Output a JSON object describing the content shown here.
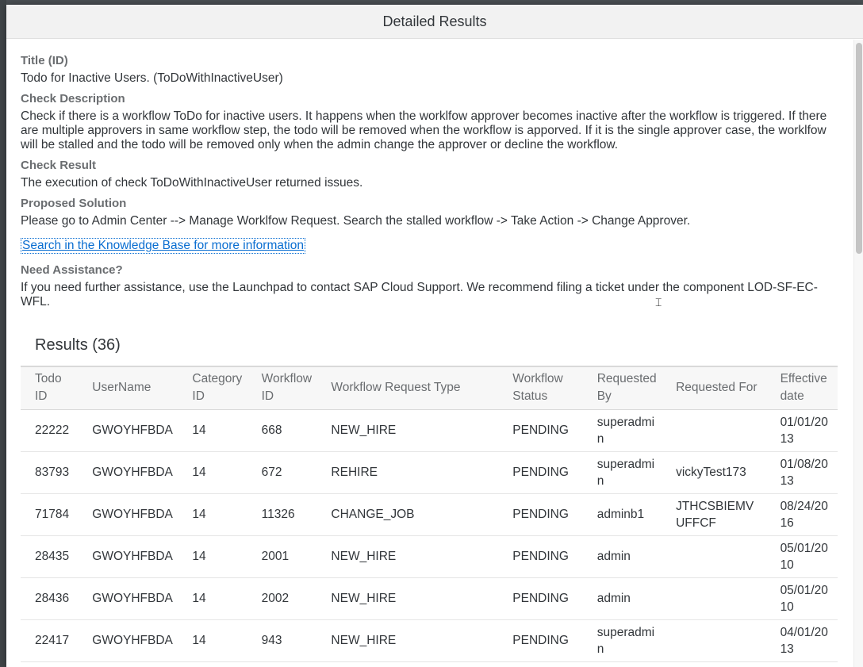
{
  "dialog": {
    "title": "Detailed Results"
  },
  "details": {
    "title_label": "Title (ID)",
    "title_value": "Todo for Inactive Users. (ToDoWithInactiveUser)",
    "description_label": "Check Description",
    "description_value": "Check if there is a workflow ToDo for inactive users. It happens when the worklfow approver becomes inactive after the workflow is triggered. If there are multiple approvers in same workflow step, the todo will be removed when the workflow is apporved. If it is the single approver case, the worklfow will be stalled and the todo will be removed only when the admin change the approver or decline the workflow.",
    "result_label": "Check Result",
    "result_value": "The execution of check ToDoWithInactiveUser returned issues.",
    "solution_label": "Proposed Solution",
    "solution_value": "Please go to Admin Center --> Manage Worklfow Request. Search the stalled workflow -> Take Action -> Change Approver.",
    "kb_link": "Search in the Knowledge Base for more information",
    "assistance_label": "Need Assistance?",
    "assistance_value": "If you need further assistance, use the Launchpad to contact SAP Cloud Support. We recommend filing a ticket under the component LOD-SF-EC-WFL."
  },
  "results": {
    "title": "Results (36)",
    "columns": [
      "Todo ID",
      "UserName",
      "Category ID",
      "Workflow ID",
      "Workflow Request Type",
      "Workflow Status",
      "Requested By",
      "Requested For",
      "Effective date"
    ],
    "rows": [
      [
        "22222",
        "GWOYHFBDA",
        "14",
        "668",
        "NEW_HIRE",
        "PENDING",
        "superadmin",
        "",
        "01/01/2013"
      ],
      [
        "83793",
        "GWOYHFBDA",
        "14",
        "672",
        "REHIRE",
        "PENDING",
        "superadmin",
        "vickyTest173",
        "01/08/2013"
      ],
      [
        "71784",
        "GWOYHFBDA",
        "14",
        "11326",
        "CHANGE_JOB",
        "PENDING",
        "adminb1",
        "JTHCSBIEMVUFFCF",
        "08/24/2016"
      ],
      [
        "28435",
        "GWOYHFBDA",
        "14",
        "2001",
        "NEW_HIRE",
        "PENDING",
        "admin",
        "",
        "05/01/2010"
      ],
      [
        "28436",
        "GWOYHFBDA",
        "14",
        "2002",
        "NEW_HIRE",
        "PENDING",
        "admin",
        "",
        "05/01/2010"
      ],
      [
        "22417",
        "GWOYHFBDA",
        "14",
        "943",
        "NEW_HIRE",
        "PENDING",
        "superadmin",
        "",
        "04/01/2013"
      ]
    ]
  }
}
